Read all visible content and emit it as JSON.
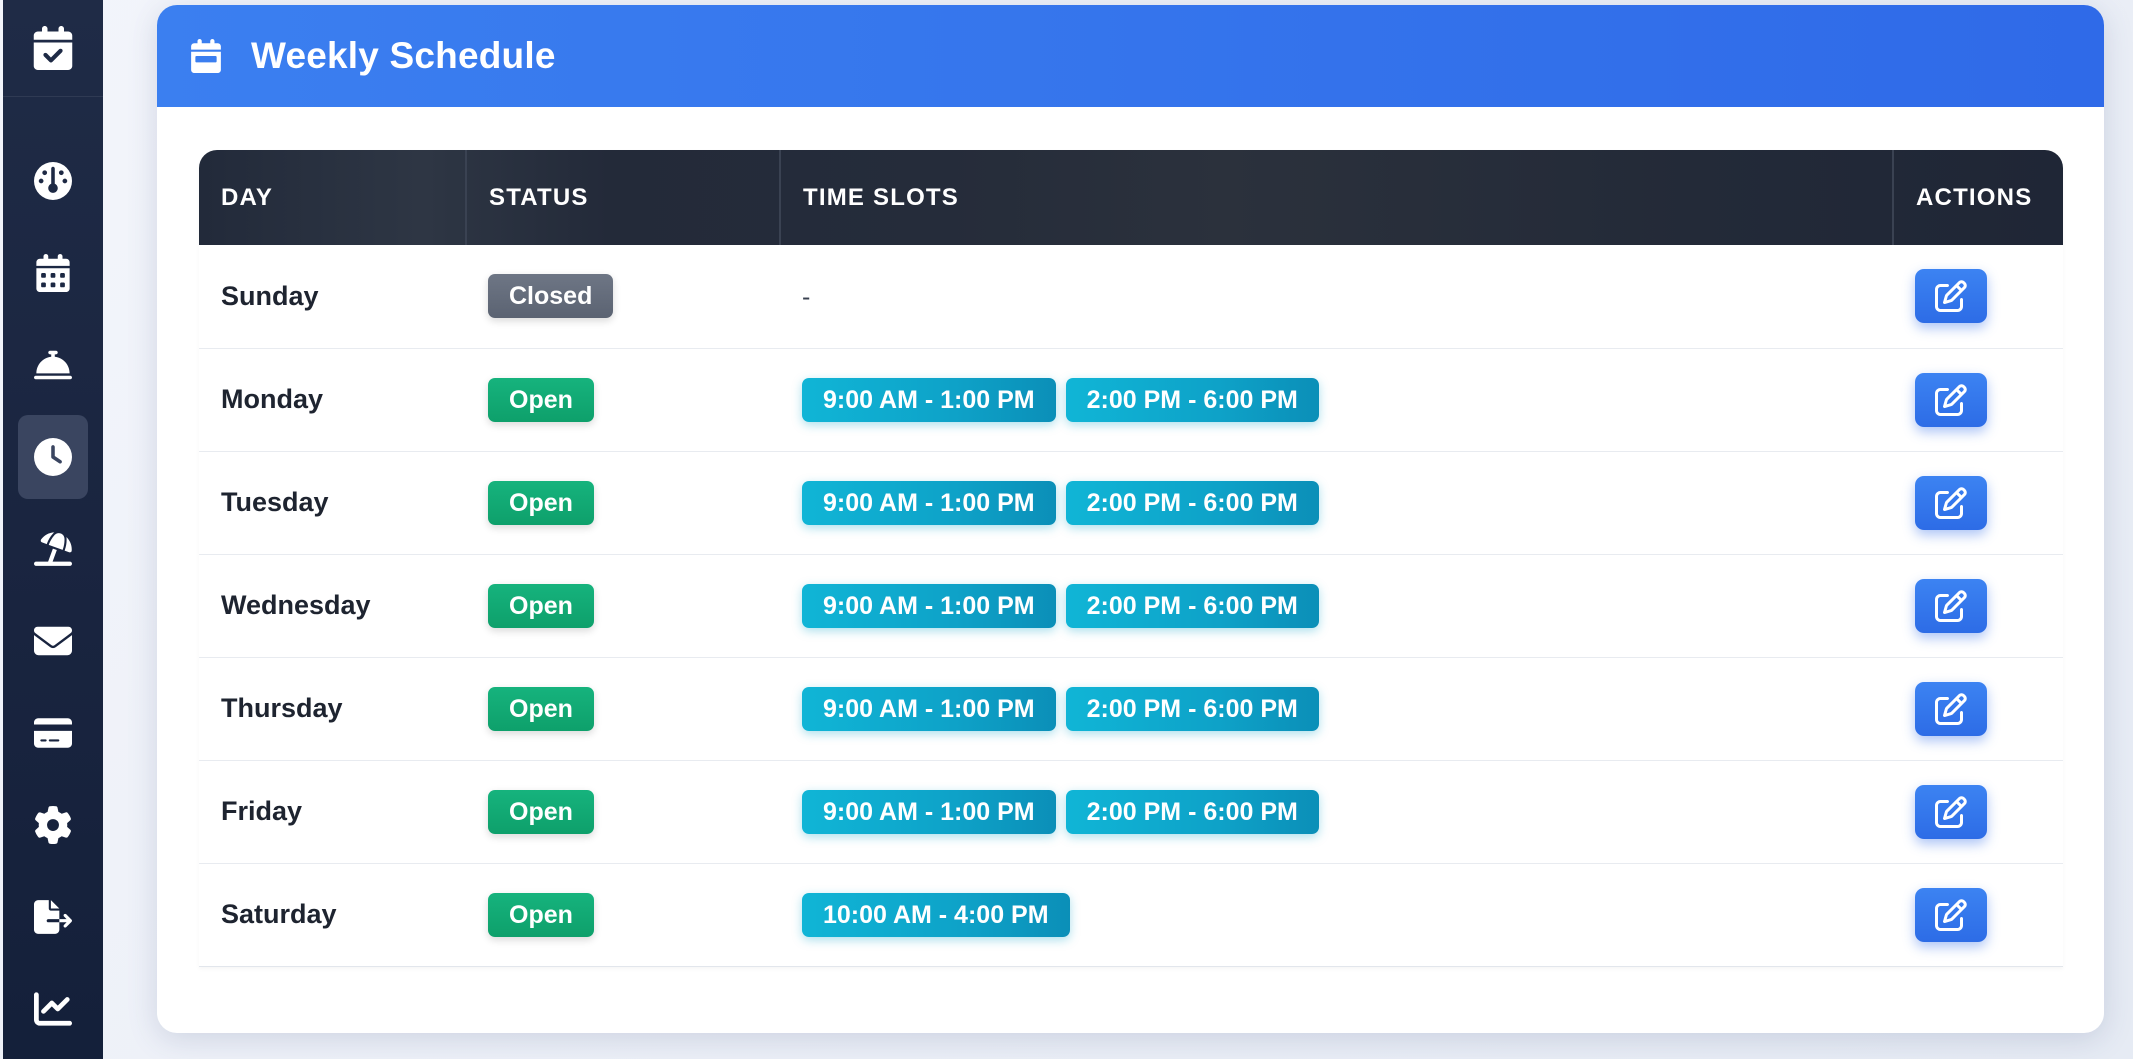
{
  "header": {
    "title": "Weekly Schedule"
  },
  "sidebar": {
    "items": [
      {
        "icon": "dashboard-icon",
        "active": false
      },
      {
        "icon": "calendar-icon",
        "active": false
      },
      {
        "icon": "bell-service-icon",
        "active": false
      },
      {
        "icon": "clock-icon",
        "active": true
      },
      {
        "icon": "umbrella-beach-icon",
        "active": false
      },
      {
        "icon": "envelope-icon",
        "active": false
      },
      {
        "icon": "credit-card-icon",
        "active": false
      },
      {
        "icon": "gear-icon",
        "active": false
      },
      {
        "icon": "file-export-icon",
        "active": false
      },
      {
        "icon": "chart-line-icon",
        "active": false
      }
    ]
  },
  "table": {
    "columns": [
      "DAY",
      "STATUS",
      "TIME SLOTS",
      "ACTIONS"
    ],
    "rows": [
      {
        "day": "Sunday",
        "status": "Closed",
        "slots": [],
        "empty": "-"
      },
      {
        "day": "Monday",
        "status": "Open",
        "slots": [
          "9:00 AM - 1:00 PM",
          "2:00 PM - 6:00 PM"
        ]
      },
      {
        "day": "Tuesday",
        "status": "Open",
        "slots": [
          "9:00 AM - 1:00 PM",
          "2:00 PM - 6:00 PM"
        ]
      },
      {
        "day": "Wednesday",
        "status": "Open",
        "slots": [
          "9:00 AM - 1:00 PM",
          "2:00 PM - 6:00 PM"
        ]
      },
      {
        "day": "Thursday",
        "status": "Open",
        "slots": [
          "9:00 AM - 1:00 PM",
          "2:00 PM - 6:00 PM"
        ]
      },
      {
        "day": "Friday",
        "status": "Open",
        "slots": [
          "9:00 AM - 1:00 PM",
          "2:00 PM - 6:00 PM"
        ]
      },
      {
        "day": "Saturday",
        "status": "Open",
        "slots": [
          "10:00 AM - 4:00 PM"
        ]
      }
    ]
  },
  "colors": {
    "primary": "#3b7ff0",
    "sidebar": "#1a2540",
    "open": "#10a872",
    "closed": "#656d7c",
    "slot": "#0ea8cc"
  }
}
